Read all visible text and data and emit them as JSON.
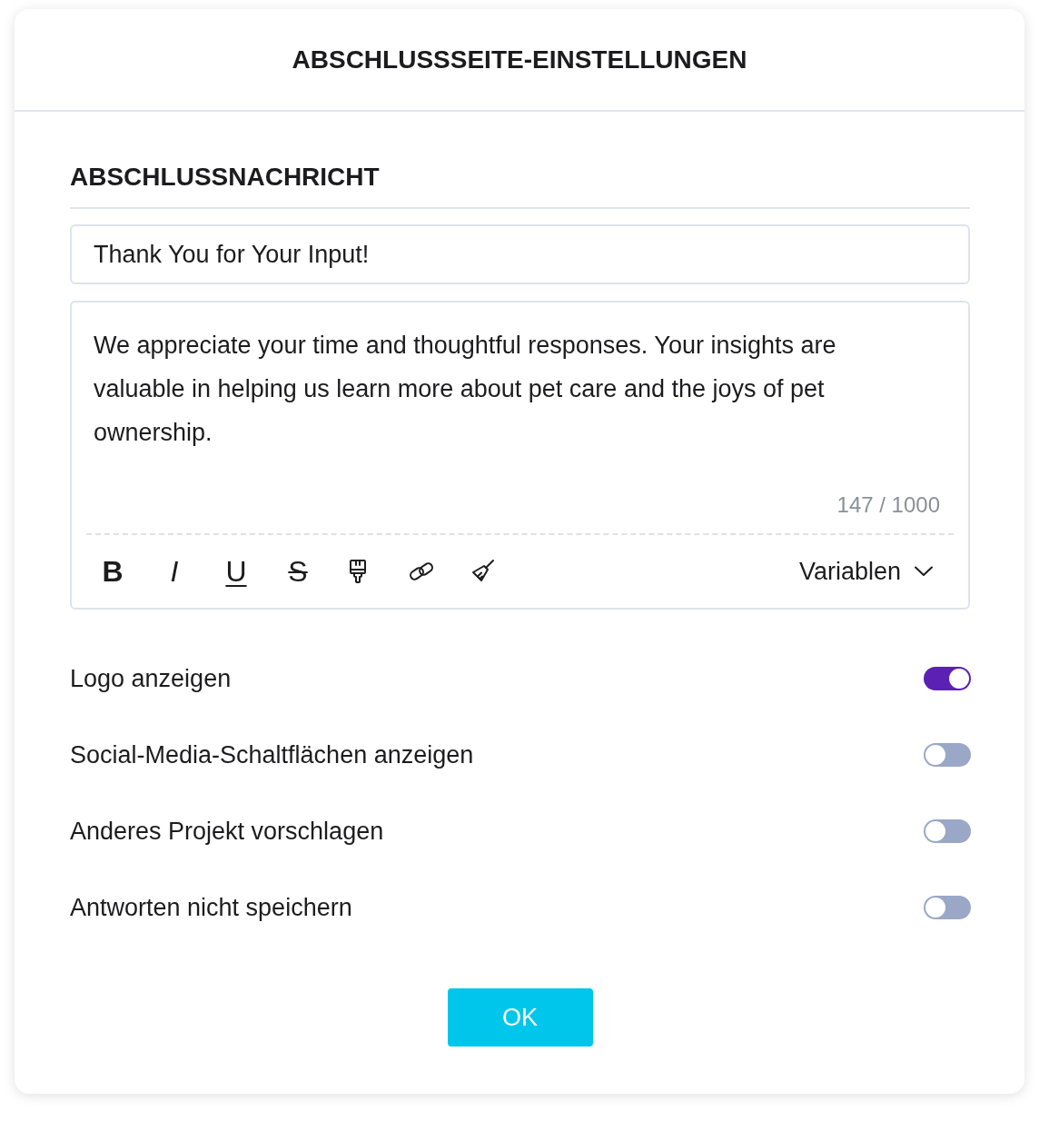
{
  "dialog": {
    "title": "ABSCHLUSSSEITE-EINSTELLUNGEN"
  },
  "section": {
    "heading": "ABSCHLUSSNACHRICHT"
  },
  "title_field": {
    "value": "Thank You for Your Input!"
  },
  "message_field": {
    "value": "We appreciate your time and thoughtful responses. Your insights are valuable in helping us learn more about pet care and the joys of pet ownership.",
    "counter": "147 / 1000"
  },
  "toolbar": {
    "buttons": [
      {
        "kind": "bold",
        "label": "B"
      },
      {
        "kind": "italic",
        "label": "I"
      },
      {
        "kind": "underline",
        "label": "U"
      },
      {
        "kind": "strike",
        "label": "S"
      },
      {
        "kind": "brush"
      },
      {
        "kind": "link"
      },
      {
        "kind": "broom"
      }
    ],
    "variables": {
      "label": "Variablen"
    }
  },
  "toggles": [
    {
      "label": "Logo anzeigen",
      "on": true
    },
    {
      "label": "Social-Media-Schaltflächen anzeigen",
      "on": false
    },
    {
      "label": "Anderes Projekt vorschlagen",
      "on": false
    },
    {
      "label": "Antworten nicht speichern",
      "on": false
    }
  ],
  "buttons": [
    {
      "label": "OK"
    }
  ]
}
